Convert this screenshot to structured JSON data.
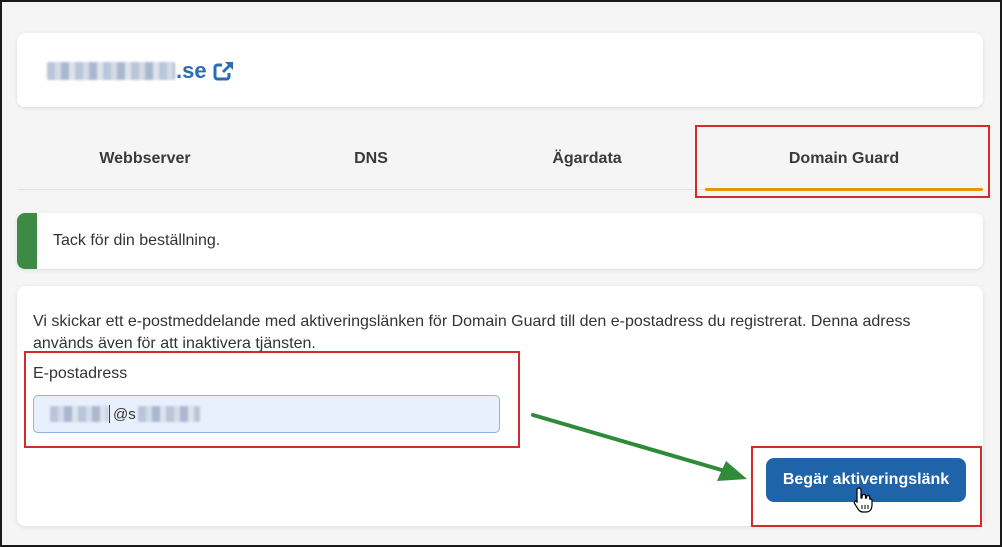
{
  "domain": {
    "tld": ".se",
    "icon": "external-link-icon"
  },
  "tabs": [
    {
      "label": "Webbserver",
      "active": false
    },
    {
      "label": "DNS",
      "active": false
    },
    {
      "label": "Ägardata",
      "active": false
    },
    {
      "label": "Domain Guard",
      "active": true
    }
  ],
  "alert": {
    "message": "Tack för din beställning.",
    "color": "#3d8a45"
  },
  "form": {
    "info": "Vi skickar ett e-postmeddelande med aktiveringslänken för Domain Guard till den e-postadress du registrerat. Denna adress används även för att inaktivera tjänsten.",
    "email_label": "E-postadress",
    "email_visible_part": "@s",
    "submit_label": "Begär aktiveringslänk"
  },
  "colors": {
    "accent_tab": "#e9940f",
    "button": "#1f63a8",
    "link": "#2a6db5",
    "annotation_box": "#d42a2a",
    "annotation_arrow": "#2e8b3a"
  }
}
